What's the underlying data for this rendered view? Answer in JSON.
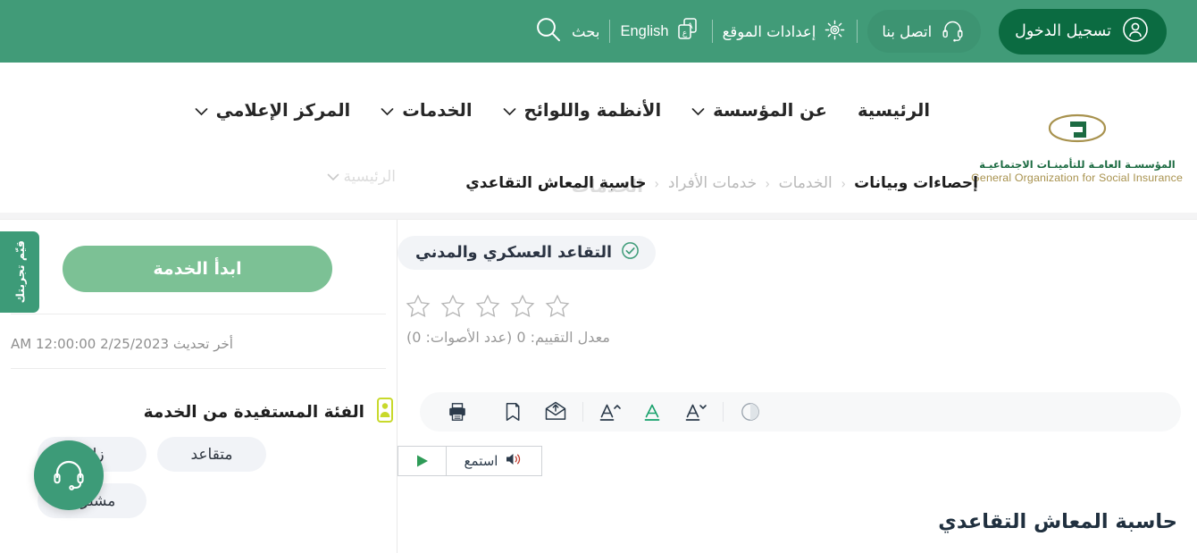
{
  "topbar": {
    "login_label": "تسجيل الدخول",
    "contact_label": "اتصل بنا",
    "settings_label": "إعدادات الموقع",
    "language_label": "English",
    "search_label": "بحث",
    "colors": {
      "bar_bg": "#419b78",
      "login_bg": "#0b6b41",
      "contact_bg": "#3d9472"
    }
  },
  "logo": {
    "arabic": "المؤسسـة العامـة للتأمينـات الاجتماعيـة",
    "english": "General Organization for Social Insurance",
    "mark_gold": "#a8924e",
    "mark_green": "#1c6b42"
  },
  "nav": {
    "items": [
      {
        "label": "الرئيسية",
        "caret": false
      },
      {
        "label": "عن المؤسسة",
        "caret": true
      },
      {
        "label": "الأنظمة واللوائح",
        "caret": true
      },
      {
        "label": "الخدمات",
        "caret": true
      },
      {
        "label": "المركز الإعلامي",
        "caret": true
      }
    ],
    "ghost_label": "الخدمات"
  },
  "breadcrumb": {
    "ghost_label": "الرئيسية",
    "items": [
      {
        "label": "إحصاءات وبيانات",
        "strong": true
      },
      {
        "label": "الخدمات",
        "strong": false
      },
      {
        "label": "خدمات الأفراد",
        "strong": false
      },
      {
        "label": "حاسبة المعاش التقاعدي",
        "strong": true
      }
    ],
    "separator": "‹"
  },
  "sidebar": {
    "start_service_label": "ابدأ الخدمة",
    "last_updated": "أخر تحديث 2/25/2023 12:00:00 AM",
    "category_title": "الفئة المستفيدة من الخدمة",
    "chips_row1": [
      "زائر",
      "متقاعد"
    ],
    "chips_row2": [
      "مشترك"
    ],
    "feedback_label": "قيّم تجربتك",
    "start_btn_color": "#7cc195"
  },
  "main": {
    "category_badge": "التقاعد العسكري والمدني",
    "rating_text": "معدل التقييم: 0 (عدد الأصوات: 0)",
    "stars_total": 5,
    "stars_filled": 0,
    "page_title": "حاسبة المعاش التقاعدي",
    "listen_label": "استمع",
    "toolbar_icons": [
      "printer-icon",
      "bookmark-icon",
      "share-envelope-icon",
      "font-increase-icon",
      "font-reset-icon",
      "font-decrease-icon",
      "contrast-icon"
    ]
  }
}
